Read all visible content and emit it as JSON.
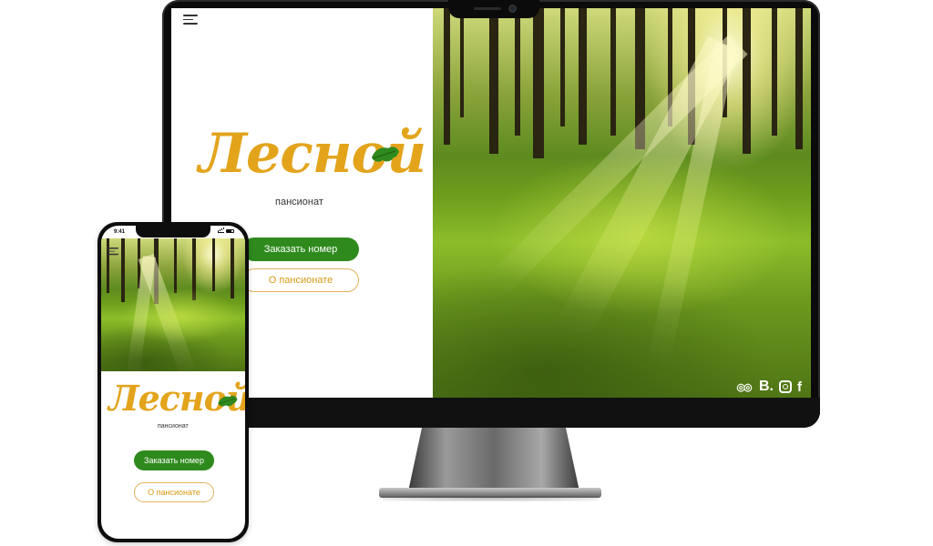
{
  "brand": {
    "name": "Лесной",
    "tagline": "пансионат",
    "color_gold": "#e3a41c",
    "color_green": "#2f8a1e"
  },
  "actions": {
    "book_label": "Заказать номер",
    "about_label": "О пансионате"
  },
  "social": [
    "tripadvisor-icon",
    "booking-icon",
    "instagram-icon",
    "facebook-icon"
  ],
  "social_text": {
    "tripadvisor": "◎◎",
    "booking": "B.",
    "facebook": "f"
  },
  "menu_icon": "hamburger-icon",
  "phone_status": {
    "time": "9:41"
  }
}
